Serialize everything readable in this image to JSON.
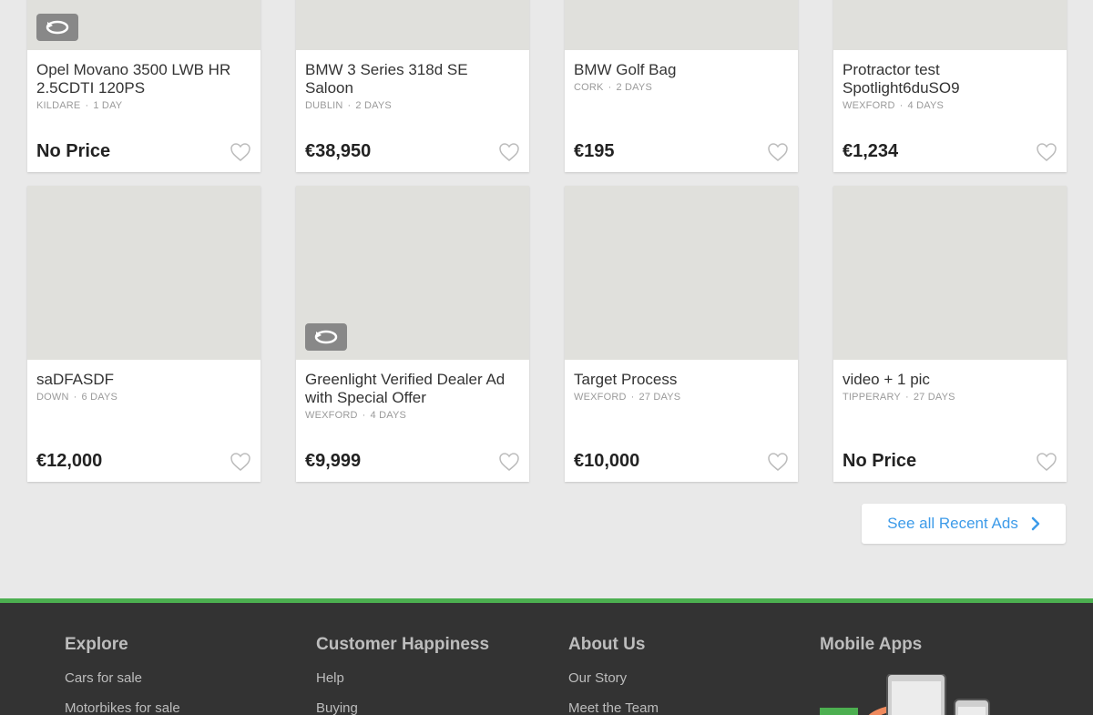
{
  "listings": [
    {
      "title": "Opel Movano 3500 LWB HR 2.5CDTI 120PS",
      "location": "KILDARE",
      "age": "1 DAY",
      "price": "No Price",
      "badge": "swap-icon"
    },
    {
      "title": "BMW 3 Series 318d SE Saloon",
      "location": "DUBLIN",
      "age": "2 DAYS",
      "price": "€38,950",
      "badge": null
    },
    {
      "title": "BMW Golf Bag",
      "location": "CORK",
      "age": "2 DAYS",
      "price": "€195",
      "badge": null
    },
    {
      "title": "Protractor test Spotlight6duSO9",
      "location": "WEXFORD",
      "age": "4 DAYS",
      "price": "€1,234",
      "badge": null
    },
    {
      "title": "saDFASDF",
      "location": "DOWN",
      "age": "6 DAYS",
      "price": "€12,000",
      "badge": null
    },
    {
      "title": "Greenlight Verified Dealer Ad with Special Offer",
      "location": "WEXFORD",
      "age": "4 DAYS",
      "price": "€9,999",
      "badge": "swap-icon"
    },
    {
      "title": "Target Process",
      "location": "WEXFORD",
      "age": "27 DAYS",
      "price": "€10,000",
      "badge": null
    },
    {
      "title": "video + 1 pic",
      "location": "TIPPERARY",
      "age": "27 DAYS",
      "price": "No Price",
      "badge": null
    }
  ],
  "see_all": {
    "label": "See all Recent Ads"
  },
  "footer": {
    "explore": {
      "heading": "Explore",
      "links": [
        "Cars for sale",
        "Motorbikes for sale"
      ]
    },
    "customer": {
      "heading": "Customer Happiness",
      "links": [
        "Help",
        "Buying"
      ]
    },
    "about": {
      "heading": "About Us",
      "links": [
        "Our Story",
        "Meet the Team"
      ]
    },
    "mobile": {
      "heading": "Mobile Apps"
    }
  },
  "colors": {
    "accent": "#3d9be9",
    "footer_bar": "#4caf50",
    "footer_bg": "#333333"
  }
}
